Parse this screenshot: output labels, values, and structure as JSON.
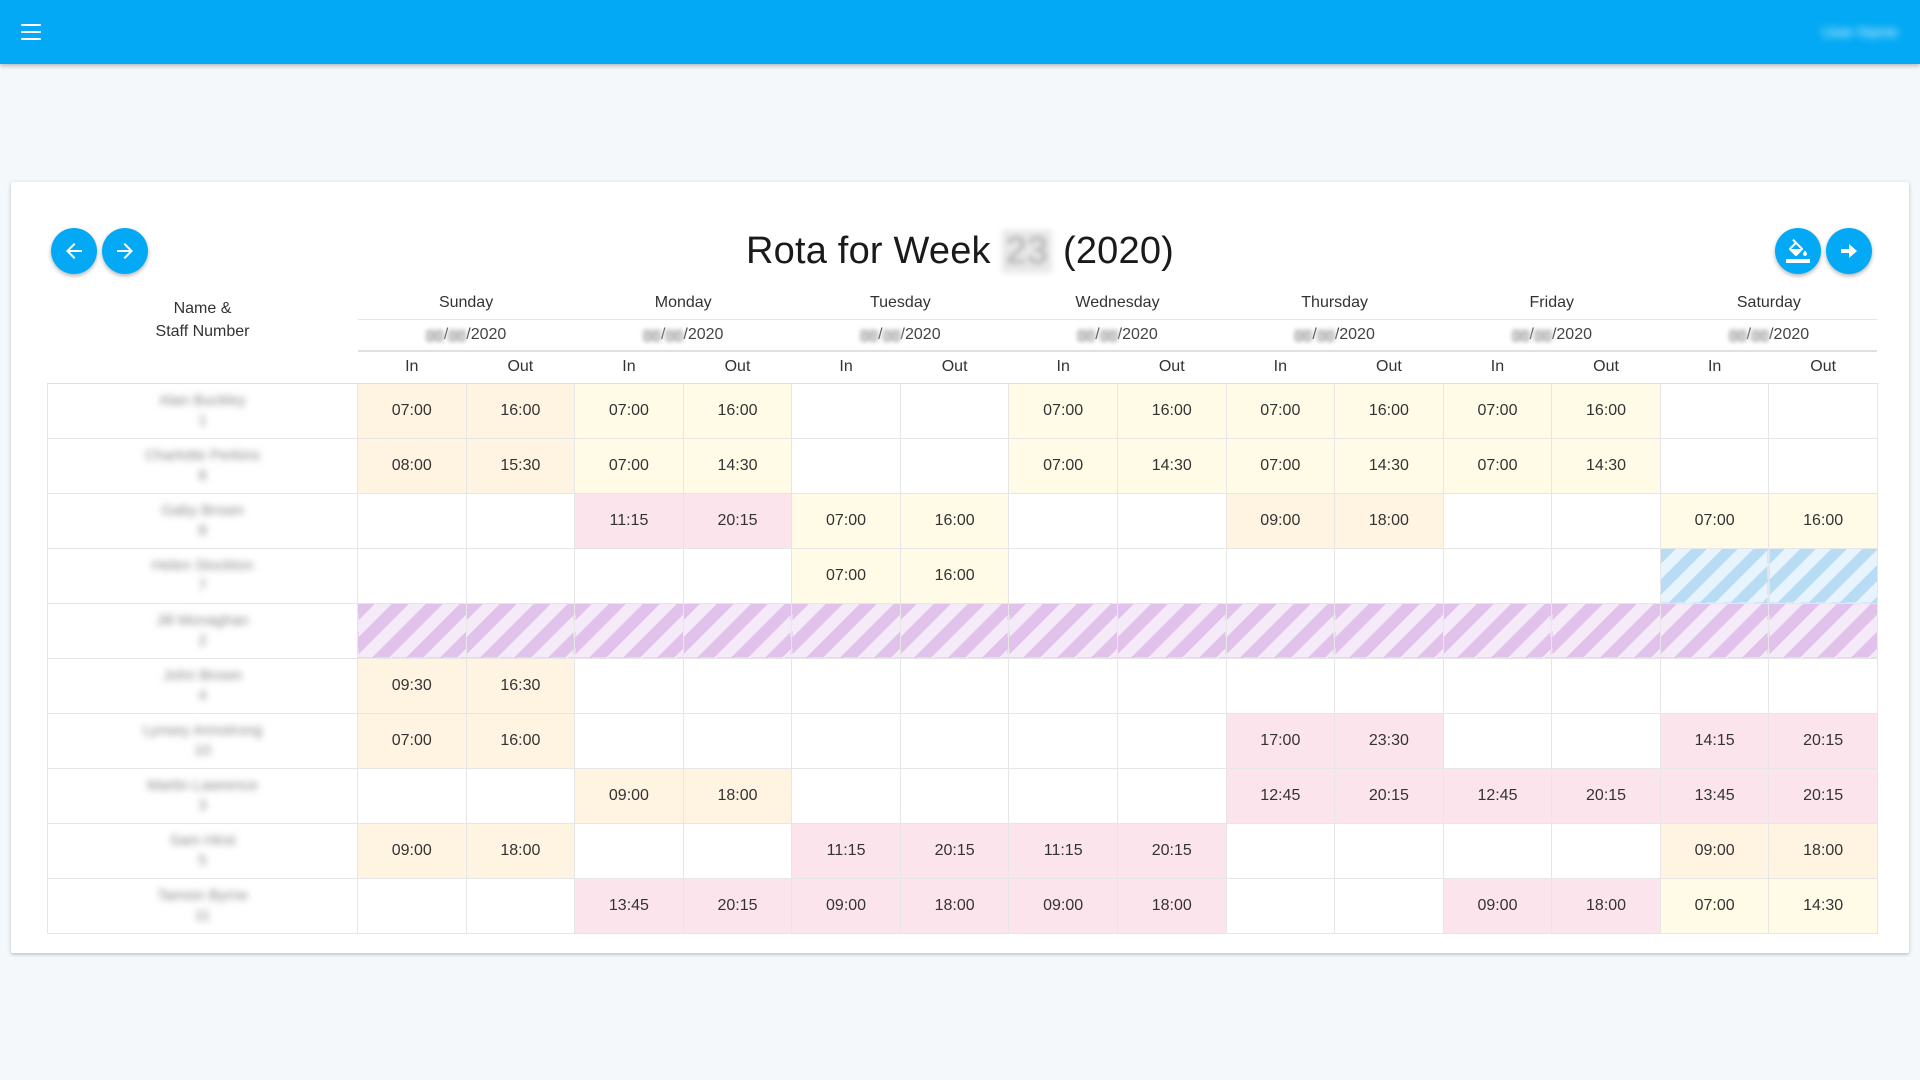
{
  "appbar": {
    "user_name": "User Name"
  },
  "title": {
    "prefix": "Rota for Week",
    "week": "23",
    "suffix": "(2020)"
  },
  "header": {
    "name_line1": "Name &",
    "name_line2": "Staff Number",
    "in_label": "In",
    "out_label": "Out",
    "days": [
      {
        "name": "Sunday",
        "day": "00",
        "month": "00",
        "year": "/2020"
      },
      {
        "name": "Monday",
        "day": "00",
        "month": "00",
        "year": "/2020"
      },
      {
        "name": "Tuesday",
        "day": "00",
        "month": "00",
        "year": "/2020"
      },
      {
        "name": "Wednesday",
        "day": "00",
        "month": "00",
        "year": "/2020"
      },
      {
        "name": "Thursday",
        "day": "00",
        "month": "00",
        "year": "/2020"
      },
      {
        "name": "Friday",
        "day": "00",
        "month": "00",
        "year": "/2020"
      },
      {
        "name": "Saturday",
        "day": "00",
        "month": "00",
        "year": "/2020"
      }
    ]
  },
  "colors": {
    "primary": "#03a9f4",
    "orange": "#fff3e1",
    "yellow": "#fffbe7",
    "pink": "#fce4ec",
    "holiday_stripe": "#e0c2ea",
    "blue_stripe": "#b9dcf5"
  },
  "buttons": {
    "prev_week_icon": "arrow-left-icon",
    "next_week_icon": "arrow-right-icon",
    "fill_icon": "paint-bucket-icon",
    "export_icon": "arrow-right-bold-icon"
  },
  "rows": [
    {
      "name": "Alan Buckley",
      "number": "1",
      "shifts": [
        {
          "in": "07:00",
          "out": "16:00",
          "color": "orange"
        },
        {
          "in": "07:00",
          "out": "16:00",
          "color": "yellow"
        },
        {
          "in": "",
          "out": "",
          "color": "none"
        },
        {
          "in": "07:00",
          "out": "16:00",
          "color": "yellow"
        },
        {
          "in": "07:00",
          "out": "16:00",
          "color": "yellow"
        },
        {
          "in": "07:00",
          "out": "16:00",
          "color": "yellow"
        },
        {
          "in": "",
          "out": "",
          "color": "none"
        }
      ]
    },
    {
      "name": "Charlotte Perkins",
      "number": "8",
      "shifts": [
        {
          "in": "08:00",
          "out": "15:30",
          "color": "orange"
        },
        {
          "in": "07:00",
          "out": "14:30",
          "color": "yellow"
        },
        {
          "in": "",
          "out": "",
          "color": "none"
        },
        {
          "in": "07:00",
          "out": "14:30",
          "color": "yellow"
        },
        {
          "in": "07:00",
          "out": "14:30",
          "color": "yellow"
        },
        {
          "in": "07:00",
          "out": "14:30",
          "color": "yellow"
        },
        {
          "in": "",
          "out": "",
          "color": "none"
        }
      ]
    },
    {
      "name": "Gaby Brown",
      "number": "8",
      "shifts": [
        {
          "in": "",
          "out": "",
          "color": "none"
        },
        {
          "in": "11:15",
          "out": "20:15",
          "color": "pink"
        },
        {
          "in": "07:00",
          "out": "16:00",
          "color": "yellow"
        },
        {
          "in": "",
          "out": "",
          "color": "none"
        },
        {
          "in": "09:00",
          "out": "18:00",
          "color": "orange"
        },
        {
          "in": "",
          "out": "",
          "color": "none"
        },
        {
          "in": "07:00",
          "out": "16:00",
          "color": "yellow"
        }
      ]
    },
    {
      "name": "Helen Stockton",
      "number": "7",
      "shifts": [
        {
          "in": "",
          "out": "",
          "color": "none"
        },
        {
          "in": "",
          "out": "",
          "color": "none"
        },
        {
          "in": "07:00",
          "out": "16:00",
          "color": "yellow"
        },
        {
          "in": "",
          "out": "",
          "color": "none"
        },
        {
          "in": "",
          "out": "",
          "color": "none"
        },
        {
          "in": "",
          "out": "",
          "color": "none"
        },
        {
          "in": "",
          "out": "",
          "color": "blue"
        }
      ]
    },
    {
      "name": "Jill Monaghan",
      "number": "2",
      "shifts": [
        {
          "in": "",
          "out": "",
          "color": "holiday"
        },
        {
          "in": "",
          "out": "",
          "color": "holiday"
        },
        {
          "in": "",
          "out": "",
          "color": "holiday"
        },
        {
          "in": "",
          "out": "",
          "color": "holiday"
        },
        {
          "in": "",
          "out": "",
          "color": "holiday"
        },
        {
          "in": "",
          "out": "",
          "color": "holiday"
        },
        {
          "in": "",
          "out": "",
          "color": "holiday"
        }
      ]
    },
    {
      "name": "John Brown",
      "number": "4",
      "shifts": [
        {
          "in": "09:30",
          "out": "16:30",
          "color": "orange"
        },
        {
          "in": "",
          "out": "",
          "color": "none"
        },
        {
          "in": "",
          "out": "",
          "color": "none"
        },
        {
          "in": "",
          "out": "",
          "color": "none"
        },
        {
          "in": "",
          "out": "",
          "color": "none"
        },
        {
          "in": "",
          "out": "",
          "color": "none"
        },
        {
          "in": "",
          "out": "",
          "color": "none"
        }
      ]
    },
    {
      "name": "Lynsey Armstrong",
      "number": "10",
      "shifts": [
        {
          "in": "07:00",
          "out": "16:00",
          "color": "orange"
        },
        {
          "in": "",
          "out": "",
          "color": "none"
        },
        {
          "in": "",
          "out": "",
          "color": "none"
        },
        {
          "in": "",
          "out": "",
          "color": "none"
        },
        {
          "in": "17:00",
          "out": "23:30",
          "color": "pink"
        },
        {
          "in": "",
          "out": "",
          "color": "none"
        },
        {
          "in": "14:15",
          "out": "20:15",
          "color": "pink"
        }
      ]
    },
    {
      "name": "Martin Lawrence",
      "number": "3",
      "shifts": [
        {
          "in": "",
          "out": "",
          "color": "none"
        },
        {
          "in": "09:00",
          "out": "18:00",
          "color": "orange"
        },
        {
          "in": "",
          "out": "",
          "color": "none"
        },
        {
          "in": "",
          "out": "",
          "color": "none"
        },
        {
          "in": "12:45",
          "out": "20:15",
          "color": "pink"
        },
        {
          "in": "12:45",
          "out": "20:15",
          "color": "pink"
        },
        {
          "in": "13:45",
          "out": "20:15",
          "color": "pink"
        }
      ]
    },
    {
      "name": "Sam Hirst",
      "number": "5",
      "shifts": [
        {
          "in": "09:00",
          "out": "18:00",
          "color": "orange"
        },
        {
          "in": "",
          "out": "",
          "color": "none"
        },
        {
          "in": "11:15",
          "out": "20:15",
          "color": "pink"
        },
        {
          "in": "11:15",
          "out": "20:15",
          "color": "pink"
        },
        {
          "in": "",
          "out": "",
          "color": "none"
        },
        {
          "in": "",
          "out": "",
          "color": "none"
        },
        {
          "in": "09:00",
          "out": "18:00",
          "color": "orange"
        }
      ]
    },
    {
      "name": "Tamsin Byrne",
      "number": "11",
      "shifts": [
        {
          "in": "",
          "out": "",
          "color": "none"
        },
        {
          "in": "13:45",
          "out": "20:15",
          "color": "pink"
        },
        {
          "in": "09:00",
          "out": "18:00",
          "color": "pink"
        },
        {
          "in": "09:00",
          "out": "18:00",
          "color": "pink"
        },
        {
          "in": "",
          "out": "",
          "color": "none"
        },
        {
          "in": "09:00",
          "out": "18:00",
          "color": "pink"
        },
        {
          "in": "07:00",
          "out": "14:30",
          "color": "yellow"
        }
      ]
    }
  ]
}
